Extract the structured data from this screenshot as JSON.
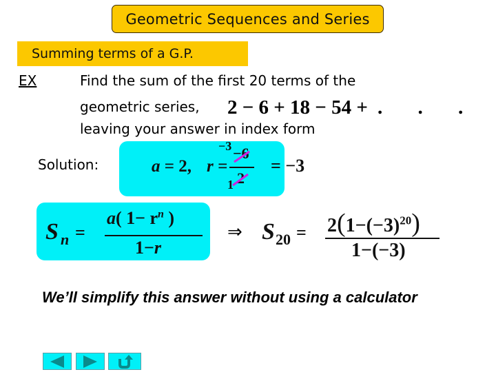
{
  "header": {
    "title": "Geometric Sequences and Series",
    "subtitle": "Summing terms of a G.P."
  },
  "example": {
    "label": "EX",
    "lines": [
      "Find the sum of the first 20 terms of the",
      "geometric series,",
      "leaving your answer in index form"
    ],
    "series": "2 − 6 + 18 − 54 +",
    "ellipsis": ". . ."
  },
  "solution": {
    "label": "Solution:",
    "a_expr": "a = 2,",
    "r_label": "r =",
    "numerator": "−6",
    "denominator": "2",
    "numerator_reduced": "−3",
    "denominator_reduced": "1",
    "result": "= −3"
  },
  "formula": {
    "lhs": "S",
    "lhs_sub": "n",
    "equals": "=",
    "numerator_a": "a",
    "numerator_body": "( 1− r",
    "numerator_exp": "n",
    "numerator_close": ")",
    "denominator": "1−r"
  },
  "substitution": {
    "implies": "⇒",
    "lhs": "S",
    "lhs_sub": "20",
    "equals": "=",
    "numerator_coef": "2",
    "numerator_inner": "1−(−3)",
    "numerator_exp": "20",
    "denominator": "1−(−3)"
  },
  "note": "We’ll simplify this answer without using a calculator",
  "nav": {
    "back_icon": "triangle-left",
    "forward_icon": "triangle-right",
    "return_icon": "u-turn-arrow",
    "button_color": "#00f0f8",
    "icon_color": "#0a8a8c"
  },
  "colors": {
    "banner": "#fcc800",
    "math_box": "#00f0f8",
    "strike": "#d020e0"
  }
}
